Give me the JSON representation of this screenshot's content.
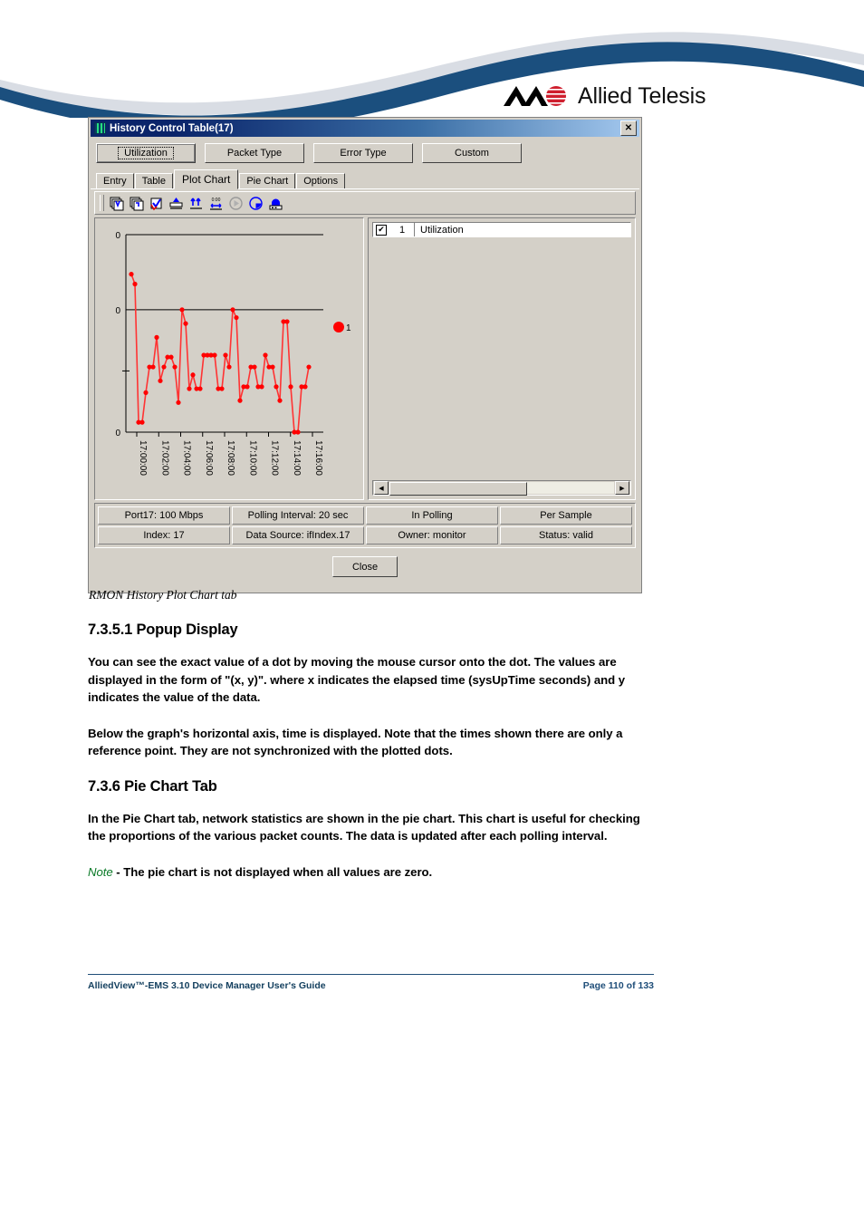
{
  "page": {
    "brand": "Allied Telesis",
    "caption": "RMON History Plot Chart tab"
  },
  "dialog": {
    "title": "History Control Table(17)",
    "close_glyph": "✕",
    "top_buttons": [
      {
        "label": "Utilization",
        "selected": true
      },
      {
        "label": "Packet Type",
        "selected": false
      },
      {
        "label": "Error Type",
        "selected": false
      },
      {
        "label": "Custom",
        "selected": false
      }
    ],
    "tabs": [
      {
        "label": "Entry",
        "active": false
      },
      {
        "label": "Table",
        "active": false
      },
      {
        "label": "Plot Chart",
        "active": true
      },
      {
        "label": "Pie Chart",
        "active": false
      },
      {
        "label": "Options",
        "active": false
      }
    ],
    "toolbar_icons": [
      "stack-down-icon",
      "stack-copy-icon",
      "stack-check-icon",
      "fit-width-icon",
      "fit-height-icon",
      "time-scale-icon",
      "play-icon",
      "pause-circle-icon",
      "print-chart-icon"
    ],
    "legend": {
      "checkbox_checked": true,
      "check_glyph": "✔",
      "index": "1",
      "label": "Utilization",
      "marker_label": "1",
      "marker_color": "#ff0000"
    },
    "scrollbar": {
      "left_glyph": "◀",
      "right_glyph": "▶"
    },
    "status": [
      [
        "Port17: 100 Mbps",
        "Polling Interval: 20 sec",
        "In Polling",
        "Per Sample"
      ],
      [
        "Index: 17",
        "Data Source: ifIndex.17",
        "Owner: monitor",
        "Status: valid"
      ]
    ],
    "close_label": "Close"
  },
  "chart_data": {
    "type": "line",
    "title": "",
    "xlabel": "",
    "ylabel": "",
    "series_name": "Utilization",
    "line_color": "#ff3333",
    "marker_color": "#ff0000",
    "ytick_labels": [
      "0",
      "0",
      "0"
    ],
    "ytick_positions": [
      1.0,
      0.62,
      0.0
    ],
    "ygrid_lines": [
      1.0,
      0.62
    ],
    "xtick_labels": [
      "17:00:00",
      "17:02:00",
      "17:04:00",
      "17:06:00",
      "17:08:00",
      "17:10:00",
      "17:12:00",
      "17:14:00",
      "17:16:00"
    ],
    "ylim": [
      0,
      1
    ],
    "grid": true,
    "legend_position": "right",
    "values": [
      0.8,
      0.75,
      0.05,
      0.05,
      0.2,
      0.33,
      0.33,
      0.48,
      0.26,
      0.33,
      0.38,
      0.38,
      0.33,
      0.15,
      0.62,
      0.55,
      0.22,
      0.29,
      0.22,
      0.22,
      0.39,
      0.39,
      0.39,
      0.39,
      0.22,
      0.22,
      0.39,
      0.33,
      0.62,
      0.58,
      0.16,
      0.23,
      0.23,
      0.33,
      0.33,
      0.23,
      0.23,
      0.39,
      0.33,
      0.33,
      0.23,
      0.16,
      0.56,
      0.56,
      0.23,
      0.0,
      0.0,
      0.23,
      0.23,
      0.33
    ]
  },
  "document": {
    "heading1": "7.3.5.1 Popup Display",
    "para1": "You can see the exact value of a dot by moving the mouse cursor onto the dot. The values are displayed in the form of \"(x, y)\". where x indicates the elapsed time (sysUpTime seconds) and y indicates the value of the data.",
    "para2": "Below the graph's horizontal axis, time is displayed. Note that the times shown there are only a reference point. They are not synchronized with the plotted dots.",
    "heading2": "7.3.6 Pie Chart Tab",
    "para3": "In the Pie Chart tab, network statistics are shown in the pie chart. This chart is useful for checking the proportions of the various packet counts. The data is updated after each polling interval.",
    "note_word": "Note",
    "note_text": " - The pie chart is not displayed when all values are zero."
  },
  "footer": {
    "left": "AlliedView™-EMS 3.10 Device Manager User's Guide",
    "right": "Page 110 of 133"
  }
}
